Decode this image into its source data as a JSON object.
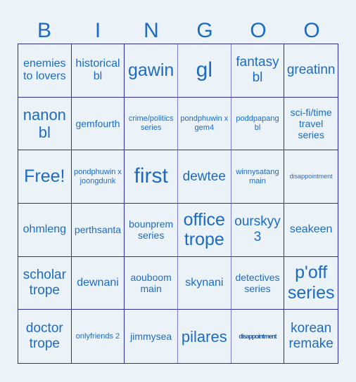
{
  "header": {
    "letters": [
      "B",
      "I",
      "N",
      "G",
      "O",
      "O"
    ]
  },
  "cells": [
    "enemies to lovers",
    "historical bl",
    "gawin",
    "gl",
    "fantasy bl",
    "greatinn",
    "nanon bl",
    "gemfourth",
    "crime/politics series",
    "pondphuwin x gem4",
    "poddpapang bl",
    "sci-fi/time travel series",
    "Free!",
    "pondphuwin x joongdunk",
    "first",
    "dewtee",
    "winnysatang main",
    "disappointment",
    "ohmleng",
    "perthsanta",
    "bounprem series",
    "office trope",
    "ourskyy 3",
    "seakeen",
    "scholar trope",
    "dewnani",
    "aouboom main",
    "skynani",
    "detectives series",
    "p'off series",
    "doctor trope",
    "onlyfriends 2",
    "jimmysea",
    "pilares",
    "disappointment",
    "korean remake"
  ],
  "colors": {
    "background": "#ecf3f8",
    "text": "#1b6bc6",
    "border": "#2e2e9e"
  }
}
